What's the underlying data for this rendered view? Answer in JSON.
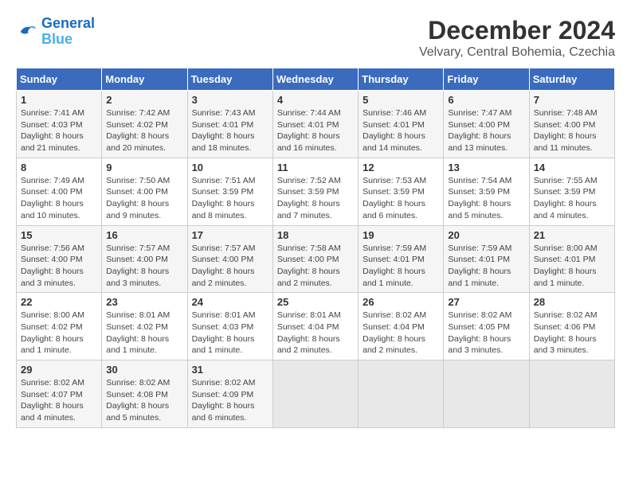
{
  "header": {
    "logo_line1": "General",
    "logo_line2": "Blue",
    "title": "December 2024",
    "subtitle": "Velvary, Central Bohemia, Czechia"
  },
  "weekdays": [
    "Sunday",
    "Monday",
    "Tuesday",
    "Wednesday",
    "Thursday",
    "Friday",
    "Saturday"
  ],
  "weeks": [
    [
      {
        "day": "1",
        "info": "Sunrise: 7:41 AM\nSunset: 4:03 PM\nDaylight: 8 hours\nand 21 minutes."
      },
      {
        "day": "2",
        "info": "Sunrise: 7:42 AM\nSunset: 4:02 PM\nDaylight: 8 hours\nand 20 minutes."
      },
      {
        "day": "3",
        "info": "Sunrise: 7:43 AM\nSunset: 4:01 PM\nDaylight: 8 hours\nand 18 minutes."
      },
      {
        "day": "4",
        "info": "Sunrise: 7:44 AM\nSunset: 4:01 PM\nDaylight: 8 hours\nand 16 minutes."
      },
      {
        "day": "5",
        "info": "Sunrise: 7:46 AM\nSunset: 4:01 PM\nDaylight: 8 hours\nand 14 minutes."
      },
      {
        "day": "6",
        "info": "Sunrise: 7:47 AM\nSunset: 4:00 PM\nDaylight: 8 hours\nand 13 minutes."
      },
      {
        "day": "7",
        "info": "Sunrise: 7:48 AM\nSunset: 4:00 PM\nDaylight: 8 hours\nand 11 minutes."
      }
    ],
    [
      {
        "day": "8",
        "info": "Sunrise: 7:49 AM\nSunset: 4:00 PM\nDaylight: 8 hours\nand 10 minutes."
      },
      {
        "day": "9",
        "info": "Sunrise: 7:50 AM\nSunset: 4:00 PM\nDaylight: 8 hours\nand 9 minutes."
      },
      {
        "day": "10",
        "info": "Sunrise: 7:51 AM\nSunset: 3:59 PM\nDaylight: 8 hours\nand 8 minutes."
      },
      {
        "day": "11",
        "info": "Sunrise: 7:52 AM\nSunset: 3:59 PM\nDaylight: 8 hours\nand 7 minutes."
      },
      {
        "day": "12",
        "info": "Sunrise: 7:53 AM\nSunset: 3:59 PM\nDaylight: 8 hours\nand 6 minutes."
      },
      {
        "day": "13",
        "info": "Sunrise: 7:54 AM\nSunset: 3:59 PM\nDaylight: 8 hours\nand 5 minutes."
      },
      {
        "day": "14",
        "info": "Sunrise: 7:55 AM\nSunset: 3:59 PM\nDaylight: 8 hours\nand 4 minutes."
      }
    ],
    [
      {
        "day": "15",
        "info": "Sunrise: 7:56 AM\nSunset: 4:00 PM\nDaylight: 8 hours\nand 3 minutes."
      },
      {
        "day": "16",
        "info": "Sunrise: 7:57 AM\nSunset: 4:00 PM\nDaylight: 8 hours\nand 3 minutes."
      },
      {
        "day": "17",
        "info": "Sunrise: 7:57 AM\nSunset: 4:00 PM\nDaylight: 8 hours\nand 2 minutes."
      },
      {
        "day": "18",
        "info": "Sunrise: 7:58 AM\nSunset: 4:00 PM\nDaylight: 8 hours\nand 2 minutes."
      },
      {
        "day": "19",
        "info": "Sunrise: 7:59 AM\nSunset: 4:01 PM\nDaylight: 8 hours\nand 1 minute."
      },
      {
        "day": "20",
        "info": "Sunrise: 7:59 AM\nSunset: 4:01 PM\nDaylight: 8 hours\nand 1 minute."
      },
      {
        "day": "21",
        "info": "Sunrise: 8:00 AM\nSunset: 4:01 PM\nDaylight: 8 hours\nand 1 minute."
      }
    ],
    [
      {
        "day": "22",
        "info": "Sunrise: 8:00 AM\nSunset: 4:02 PM\nDaylight: 8 hours\nand 1 minute."
      },
      {
        "day": "23",
        "info": "Sunrise: 8:01 AM\nSunset: 4:02 PM\nDaylight: 8 hours\nand 1 minute."
      },
      {
        "day": "24",
        "info": "Sunrise: 8:01 AM\nSunset: 4:03 PM\nDaylight: 8 hours\nand 1 minute."
      },
      {
        "day": "25",
        "info": "Sunrise: 8:01 AM\nSunset: 4:04 PM\nDaylight: 8 hours\nand 2 minutes."
      },
      {
        "day": "26",
        "info": "Sunrise: 8:02 AM\nSunset: 4:04 PM\nDaylight: 8 hours\nand 2 minutes."
      },
      {
        "day": "27",
        "info": "Sunrise: 8:02 AM\nSunset: 4:05 PM\nDaylight: 8 hours\nand 3 minutes."
      },
      {
        "day": "28",
        "info": "Sunrise: 8:02 AM\nSunset: 4:06 PM\nDaylight: 8 hours\nand 3 minutes."
      }
    ],
    [
      {
        "day": "29",
        "info": "Sunrise: 8:02 AM\nSunset: 4:07 PM\nDaylight: 8 hours\nand 4 minutes."
      },
      {
        "day": "30",
        "info": "Sunrise: 8:02 AM\nSunset: 4:08 PM\nDaylight: 8 hours\nand 5 minutes."
      },
      {
        "day": "31",
        "info": "Sunrise: 8:02 AM\nSunset: 4:09 PM\nDaylight: 8 hours\nand 6 minutes."
      },
      {
        "day": "",
        "info": ""
      },
      {
        "day": "",
        "info": ""
      },
      {
        "day": "",
        "info": ""
      },
      {
        "day": "",
        "info": ""
      }
    ]
  ]
}
